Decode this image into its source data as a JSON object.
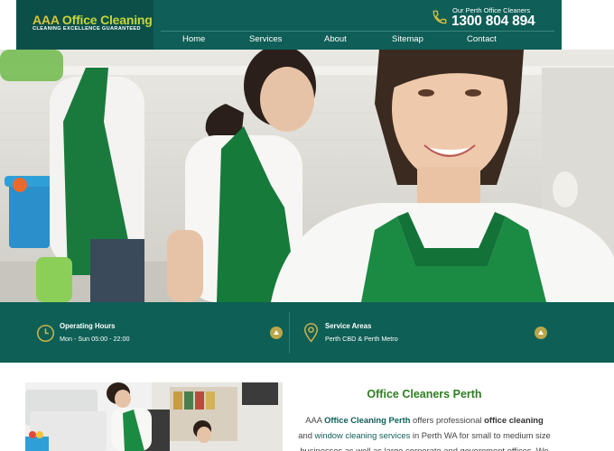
{
  "brand": {
    "name_first": "AAA",
    "name_rest": "Office Cleaning",
    "tagline": "CLEANING EXCELLENCE GUARANTEED"
  },
  "contact": {
    "label": "Our Perth Office Cleaners",
    "phone": "1300 804 894",
    "icon": "phone-icon"
  },
  "nav": {
    "items": [
      "Home",
      "Services",
      "About",
      "Sitemap",
      "Contact"
    ]
  },
  "info": {
    "hours_title": "Operating Hours",
    "hours_text": "Mon - Sun 05:00 - 22:00",
    "areas_title": "Service Areas",
    "areas_text": "Perth CBD & Perth Metro"
  },
  "intro": {
    "title": "Office Cleaners Perth",
    "p1": "AAA ",
    "p1_link": "Office Cleaning Perth",
    "p2": " offers professional ",
    "p2_bold": "office cleaning",
    "p3": " and ",
    "p3_link": "window cleaning services",
    "p4": " in Perth WA for small to medium size businesses as well as large corporate and government offices. We"
  },
  "colors": {
    "brand_teal": "#0f5e57",
    "logo_yellow": "#c7d63b",
    "accent_gold": "#b9a64a",
    "heading_green": "#2e7d22"
  }
}
